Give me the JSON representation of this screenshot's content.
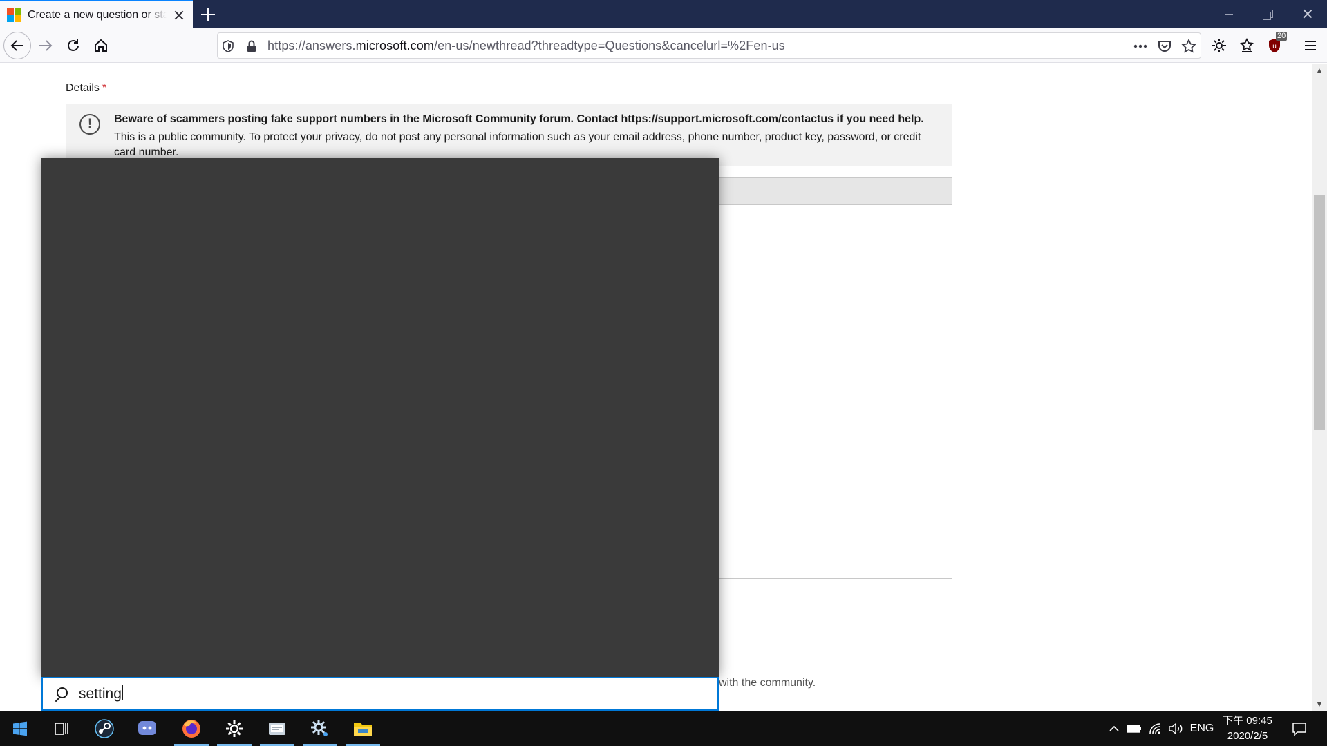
{
  "browser": {
    "tab_title": "Create a new question or start a discussion",
    "url_prefix": "https://answers.",
    "url_domain": "microsoft.com",
    "url_suffix": "/en-us/newthread?threadtype=Questions&cancelurl=%2Fen-us",
    "badge_count": "20"
  },
  "page": {
    "details_label": "Details",
    "required_marker": "*",
    "notice_bold": "Beware of scammers posting fake support numbers in the Microsoft Community forum. Contact https://support.microsoft.com/contactus if you need help.",
    "notice_text": "This is a public community. To protect your privacy, do not post any personal information such as your email address, phone number, product key, password, or credit card number.",
    "share_text": "with the community."
  },
  "search": {
    "value": "setting"
  },
  "taskbar": {
    "language": "ENG",
    "time": "下午 09:45",
    "date": "2020/2/5"
  },
  "colors": {
    "titlebar": "#1f2b4d",
    "accent": "#0078d7",
    "start_panel": "#3a3a3a",
    "taskbar": "#101010"
  }
}
